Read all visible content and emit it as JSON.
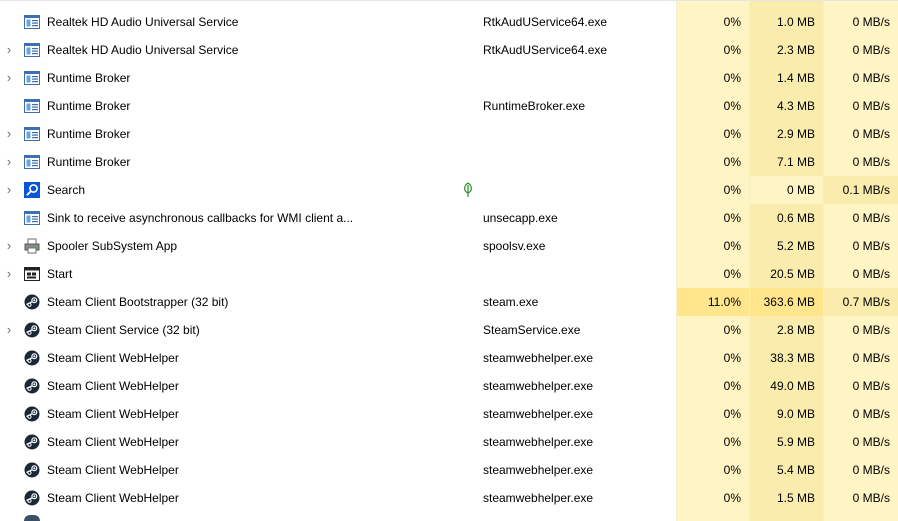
{
  "colors": {
    "heat_light": "#fff4c4",
    "heat_mid": "#f9ecad",
    "heat_high": "#ffe58c",
    "leaf_green": "#2e8b2e"
  },
  "rows": [
    {
      "expandable": false,
      "icon": "service-window-icon",
      "name": "Realtek HD Audio Universal Service",
      "image": "RtkAudUService64.exe",
      "status_icon": "",
      "cpu": "0%",
      "memory": "1.0 MB",
      "disk": "0 MB/s",
      "cpu_heat": "light",
      "mem_heat": "mid",
      "disk_heat": "light"
    },
    {
      "expandable": true,
      "icon": "service-window-icon",
      "name": "Realtek HD Audio Universal Service",
      "image": "RtkAudUService64.exe",
      "status_icon": "",
      "cpu": "0%",
      "memory": "2.3 MB",
      "disk": "0 MB/s",
      "cpu_heat": "light",
      "mem_heat": "mid",
      "disk_heat": "light"
    },
    {
      "expandable": true,
      "icon": "service-window-icon",
      "name": "Runtime Broker",
      "image": "",
      "status_icon": "",
      "cpu": "0%",
      "memory": "1.4 MB",
      "disk": "0 MB/s",
      "cpu_heat": "light",
      "mem_heat": "mid",
      "disk_heat": "light"
    },
    {
      "expandable": false,
      "icon": "service-window-icon",
      "name": "Runtime Broker",
      "image": "RuntimeBroker.exe",
      "status_icon": "",
      "cpu": "0%",
      "memory": "4.3 MB",
      "disk": "0 MB/s",
      "cpu_heat": "light",
      "mem_heat": "mid",
      "disk_heat": "light"
    },
    {
      "expandable": true,
      "icon": "service-window-icon",
      "name": "Runtime Broker",
      "image": "",
      "status_icon": "",
      "cpu": "0%",
      "memory": "2.9 MB",
      "disk": "0 MB/s",
      "cpu_heat": "light",
      "mem_heat": "mid",
      "disk_heat": "light"
    },
    {
      "expandable": true,
      "icon": "service-window-icon",
      "name": "Runtime Broker",
      "image": "",
      "status_icon": "",
      "cpu": "0%",
      "memory": "7.1 MB",
      "disk": "0 MB/s",
      "cpu_heat": "light",
      "mem_heat": "mid",
      "disk_heat": "light"
    },
    {
      "expandable": true,
      "icon": "search-icon",
      "name": "Search",
      "image": "",
      "status_icon": "leaf-icon",
      "cpu": "0%",
      "memory": "0 MB",
      "disk": "0.1 MB/s",
      "cpu_heat": "light",
      "mem_heat": "light",
      "disk_heat": "mid"
    },
    {
      "expandable": false,
      "icon": "service-window-icon",
      "name": "Sink to receive asynchronous callbacks for WMI client a...",
      "image": "unsecapp.exe",
      "status_icon": "",
      "cpu": "0%",
      "memory": "0.6 MB",
      "disk": "0 MB/s",
      "cpu_heat": "light",
      "mem_heat": "mid",
      "disk_heat": "light"
    },
    {
      "expandable": true,
      "icon": "printer-icon",
      "name": "Spooler SubSystem App",
      "image": "spoolsv.exe",
      "status_icon": "",
      "cpu": "0%",
      "memory": "5.2 MB",
      "disk": "0 MB/s",
      "cpu_heat": "light",
      "mem_heat": "mid",
      "disk_heat": "light"
    },
    {
      "expandable": true,
      "icon": "start-icon",
      "name": "Start",
      "image": "",
      "status_icon": "",
      "cpu": "0%",
      "memory": "20.5 MB",
      "disk": "0 MB/s",
      "cpu_heat": "light",
      "mem_heat": "mid",
      "disk_heat": "light"
    },
    {
      "expandable": false,
      "icon": "steam-icon",
      "name": "Steam Client Bootstrapper (32 bit)",
      "image": "steam.exe",
      "status_icon": "",
      "cpu": "11.0%",
      "memory": "363.6 MB",
      "disk": "0.7 MB/s",
      "cpu_heat": "high",
      "mem_heat": "high",
      "disk_heat": "mid"
    },
    {
      "expandable": true,
      "icon": "steam-icon",
      "name": "Steam Client Service (32 bit)",
      "image": "SteamService.exe",
      "status_icon": "",
      "cpu": "0%",
      "memory": "2.8 MB",
      "disk": "0 MB/s",
      "cpu_heat": "light",
      "mem_heat": "mid",
      "disk_heat": "light"
    },
    {
      "expandable": false,
      "icon": "steam-icon",
      "name": "Steam Client WebHelper",
      "image": "steamwebhelper.exe",
      "status_icon": "",
      "cpu": "0%",
      "memory": "38.3 MB",
      "disk": "0 MB/s",
      "cpu_heat": "light",
      "mem_heat": "mid",
      "disk_heat": "light"
    },
    {
      "expandable": false,
      "icon": "steam-icon",
      "name": "Steam Client WebHelper",
      "image": "steamwebhelper.exe",
      "status_icon": "",
      "cpu": "0%",
      "memory": "49.0 MB",
      "disk": "0 MB/s",
      "cpu_heat": "light",
      "mem_heat": "mid",
      "disk_heat": "light"
    },
    {
      "expandable": false,
      "icon": "steam-icon",
      "name": "Steam Client WebHelper",
      "image": "steamwebhelper.exe",
      "status_icon": "",
      "cpu": "0%",
      "memory": "9.0 MB",
      "disk": "0 MB/s",
      "cpu_heat": "light",
      "mem_heat": "mid",
      "disk_heat": "light"
    },
    {
      "expandable": false,
      "icon": "steam-icon",
      "name": "Steam Client WebHelper",
      "image": "steamwebhelper.exe",
      "status_icon": "",
      "cpu": "0%",
      "memory": "5.9 MB",
      "disk": "0 MB/s",
      "cpu_heat": "light",
      "mem_heat": "mid",
      "disk_heat": "light"
    },
    {
      "expandable": false,
      "icon": "steam-icon",
      "name": "Steam Client WebHelper",
      "image": "steamwebhelper.exe",
      "status_icon": "",
      "cpu": "0%",
      "memory": "5.4 MB",
      "disk": "0 MB/s",
      "cpu_heat": "light",
      "mem_heat": "mid",
      "disk_heat": "light"
    },
    {
      "expandable": false,
      "icon": "steam-icon",
      "name": "Steam Client WebHelper",
      "image": "steamwebhelper.exe",
      "status_icon": "",
      "cpu": "0%",
      "memory": "1.5 MB",
      "disk": "0 MB/s",
      "cpu_heat": "light",
      "mem_heat": "mid",
      "disk_heat": "light"
    }
  ]
}
